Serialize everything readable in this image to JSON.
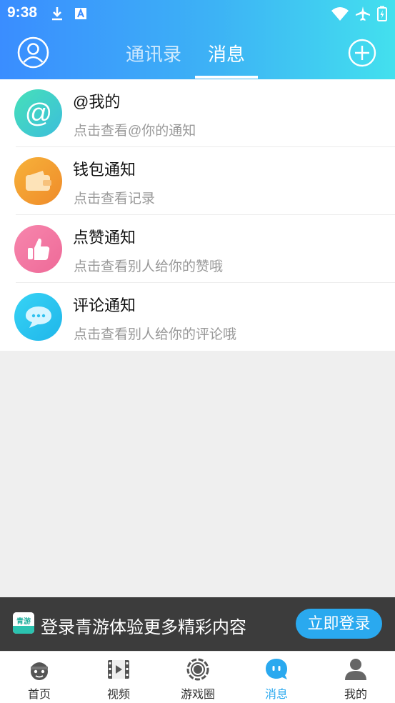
{
  "status_bar": {
    "time": "9:38"
  },
  "header": {
    "tabs": [
      {
        "label": "通讯录",
        "active": false
      },
      {
        "label": "消息",
        "active": true
      }
    ]
  },
  "messages": [
    {
      "title": "@我的",
      "subtitle": "点击查看@你的通知",
      "icon": "at-icon",
      "color": "#3ed0c3"
    },
    {
      "title": "钱包通知",
      "subtitle": "点击查看记录",
      "icon": "wallet-icon",
      "color": "#f29a2e"
    },
    {
      "title": "点赞通知",
      "subtitle": "点击查看别人给你的赞哦",
      "icon": "thumbs-up-icon",
      "color": "#f26f9f"
    },
    {
      "title": "评论通知",
      "subtitle": "点击查看别人给你的评论哦",
      "icon": "comment-icon",
      "color": "#26c3ef"
    }
  ],
  "login_banner": {
    "logo_text": "青游",
    "text": "登录青游体验更多精彩内容",
    "button_label": "立即登录"
  },
  "bottom_nav": [
    {
      "label": "首页",
      "icon": "home-mascot-icon",
      "active": false
    },
    {
      "label": "视频",
      "icon": "video-icon",
      "active": false
    },
    {
      "label": "游戏圈",
      "icon": "game-circle-icon",
      "active": false
    },
    {
      "label": "消息",
      "icon": "message-icon",
      "active": true
    },
    {
      "label": "我的",
      "icon": "profile-icon",
      "active": false
    }
  ],
  "colors": {
    "accent": "#2aa9ef",
    "header_start": "#3a8dff",
    "header_end": "#43e0ee"
  }
}
